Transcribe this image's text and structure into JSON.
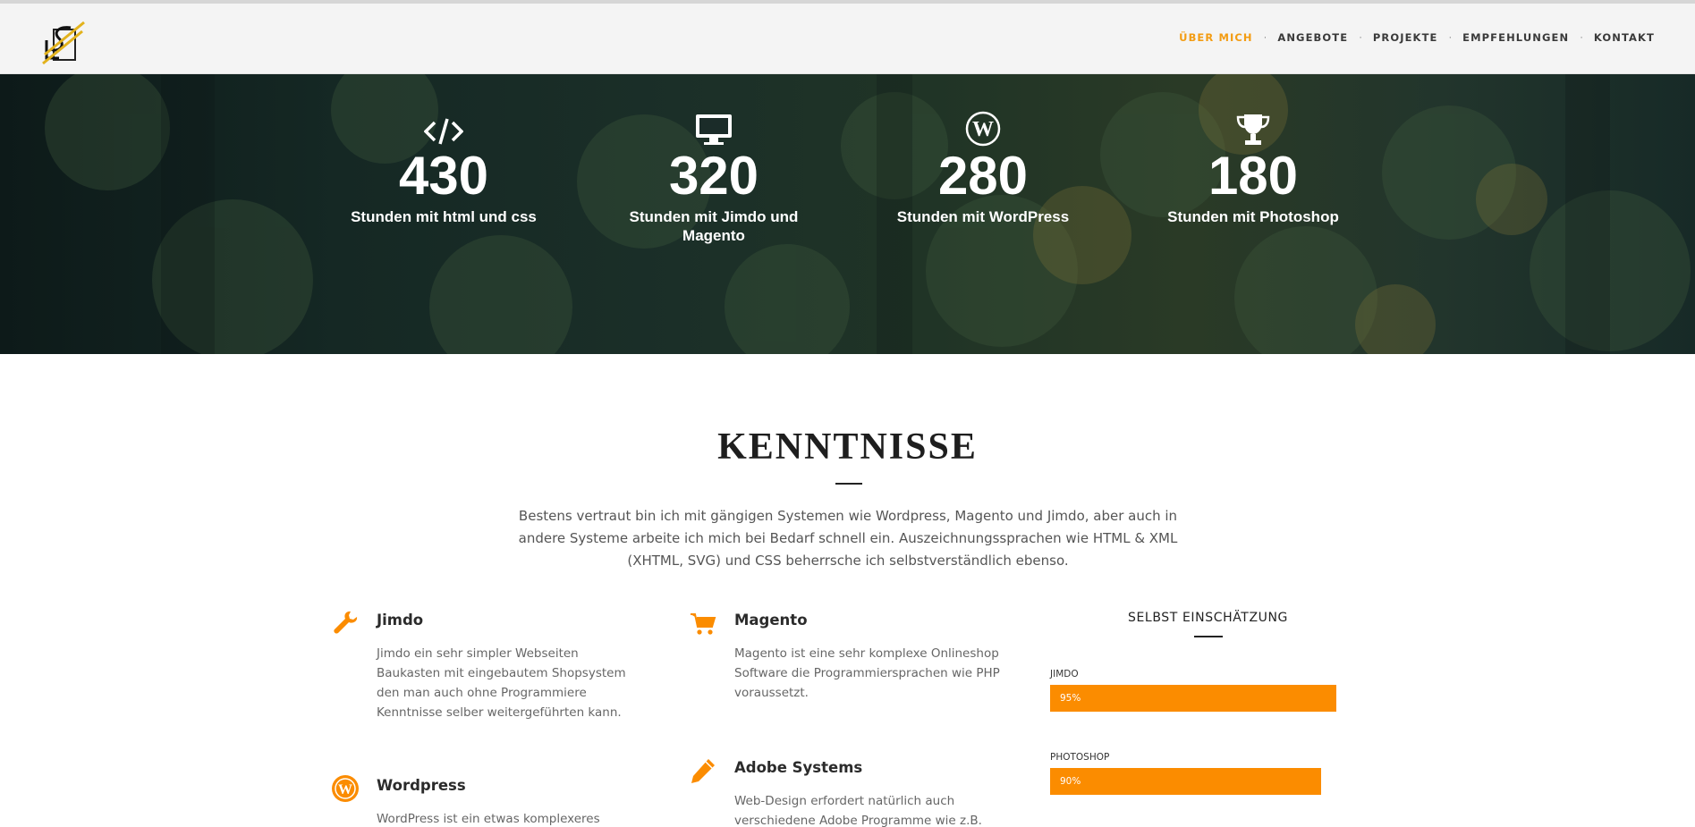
{
  "colors": {
    "accent": "#fb8c00",
    "nav_active": "#f39c12",
    "logo_gold": "#e2b21c"
  },
  "nav": {
    "items": [
      {
        "label": "ÜBER MICH",
        "active": true
      },
      {
        "label": "ANGEBOTE",
        "active": false
      },
      {
        "label": "PROJEKTE",
        "active": false
      },
      {
        "label": "EMPFEHLUNGEN",
        "active": false
      },
      {
        "label": "KONTAKT",
        "active": false
      }
    ],
    "separator": "·"
  },
  "stats": [
    {
      "icon": "code-icon",
      "value": "430",
      "label": "Stunden mit html und css"
    },
    {
      "icon": "monitor-icon",
      "value": "320",
      "label": "Stunden mit Jimdo und Magento"
    },
    {
      "icon": "wordpress-icon",
      "value": "280",
      "label": "Stunden mit WordPress"
    },
    {
      "icon": "trophy-icon",
      "value": "180",
      "label": "Stunden mit Photoshop"
    }
  ],
  "skills_section": {
    "title": "KENNTNISSE",
    "intro": "Bestens vertraut bin ich mit gängigen Systemen wie Wordpress, Magento und Jimdo, aber auch in andere Systeme arbeite ich mich bei Bedarf schnell ein. Auszeichnungssprachen wie HTML & XML (XHTML, SVG) und CSS beherrsche ich selbstverständlich ebenso.",
    "items": [
      {
        "icon": "wrench-icon",
        "title": "Jimdo",
        "text": "Jimdo ein sehr simpler Webseiten Baukasten mit eingebautem Shopsystem den man auch ohne Programmiere Kenntnisse selber weitergeführten kann."
      },
      {
        "icon": "cart-icon",
        "title": "Magento",
        "text": "Magento ist eine sehr komplexe Onlineshop Software die Programmiersprachen wie PHP voraussetzt."
      },
      {
        "icon": "wordpress-icon",
        "title": "Wordpress",
        "text": "WordPress ist ein etwas komplexeres"
      },
      {
        "icon": "pencil-icon",
        "title": "Adobe Systems",
        "text": "Web-Design erfordert natürlich auch verschiedene Adobe Programme wie z.B."
      }
    ],
    "self_assessment": {
      "title": "SELBST EINSCHÄTZUNG",
      "bars": [
        {
          "label": "JIMDO",
          "percent": 95,
          "text": "95%"
        },
        {
          "label": "PHOTOSHOP",
          "percent": 90,
          "text": "90%"
        }
      ]
    }
  }
}
